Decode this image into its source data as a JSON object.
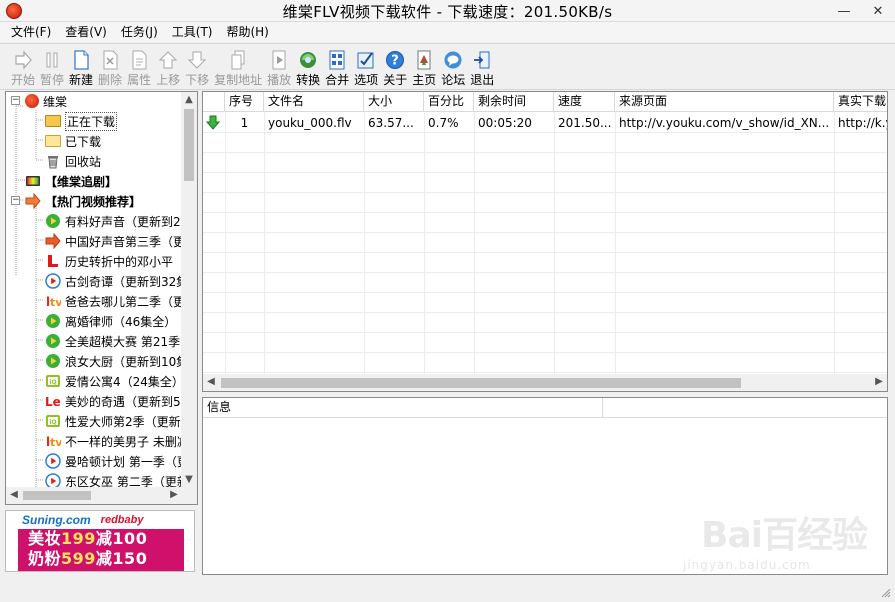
{
  "window": {
    "title": "维棠FLV视频下载软件 - 下载速度：201.50KB/s",
    "icons": {
      "app": "vidown-logo-icon",
      "minimize": "minimize-icon",
      "close": "close-icon"
    }
  },
  "menu": [
    {
      "label": "文件(F)"
    },
    {
      "label": "查看(V)"
    },
    {
      "label": "任务(J)"
    },
    {
      "label": "工具(T)"
    },
    {
      "label": "帮助(H)"
    }
  ],
  "toolbar": [
    {
      "label": "开始",
      "icon": "start-arrow-icon",
      "enabled": false
    },
    {
      "label": "暂停",
      "icon": "pause-icon",
      "enabled": false
    },
    {
      "label": "新建",
      "icon": "new-file-icon",
      "enabled": true
    },
    {
      "label": "删除",
      "icon": "delete-icon",
      "enabled": false
    },
    {
      "label": "属性",
      "icon": "properties-icon",
      "enabled": false
    },
    {
      "label": "上移",
      "icon": "move-up-icon",
      "enabled": false
    },
    {
      "label": "下移",
      "icon": "move-down-icon",
      "enabled": false
    },
    {
      "label": "复制地址",
      "icon": "copy-address-icon",
      "enabled": false
    },
    {
      "label": "播放",
      "icon": "play-icon",
      "enabled": false
    },
    {
      "label": "转换",
      "icon": "convert-icon",
      "enabled": true
    },
    {
      "label": "合并",
      "icon": "merge-icon",
      "enabled": true
    },
    {
      "label": "选项",
      "icon": "options-icon",
      "enabled": true
    },
    {
      "label": "关于",
      "icon": "about-icon",
      "enabled": true
    },
    {
      "label": "主页",
      "icon": "homepage-icon",
      "enabled": true
    },
    {
      "label": "论坛",
      "icon": "forum-icon",
      "enabled": true
    },
    {
      "label": "退出",
      "icon": "exit-icon",
      "enabled": true
    }
  ],
  "tree": {
    "root": {
      "label": "维棠",
      "icon": "vidown-logo-icon"
    },
    "children": [
      {
        "label": "正在下载",
        "icon": "downloading-folder-icon",
        "selected": true
      },
      {
        "label": "已下载",
        "icon": "downloaded-folder-icon"
      },
      {
        "label": "回收站",
        "icon": "recycle-bin-icon"
      }
    ],
    "drama": {
      "label": "【维棠追剧】",
      "icon": "tv-icon"
    },
    "hot": {
      "label": "【热门视频推荐】",
      "icon": "hot-arrow-icon"
    },
    "videos": [
      {
        "label": "有料好声音（更新到2",
        "icon": "tencent-video-icon"
      },
      {
        "label": "中国好声音第三季（更",
        "icon": "arrow-right-icon"
      },
      {
        "label": "历史转折中的邓小平（",
        "icon": "letv-l-icon"
      },
      {
        "label": "古剑奇谭（更新到32集",
        "icon": "youku-play-icon"
      },
      {
        "label": "爸爸去哪儿第二季（更",
        "icon": "letv-tv-icon"
      },
      {
        "label": "离婚律师（46集全）",
        "icon": "tencent-video-icon"
      },
      {
        "label": "全美超模大赛 第21季",
        "icon": "tencent-video-icon"
      },
      {
        "label": "浪女大厨（更新到10集",
        "icon": "tencent-video-icon"
      },
      {
        "label": "爱情公寓4（24集全）",
        "icon": "iqiyi-icon"
      },
      {
        "label": "美妙的奇遇（更新到5",
        "icon": "le-icon"
      },
      {
        "label": "性爱大师第2季（更新",
        "icon": "iqiyi-icon"
      },
      {
        "label": "不一样的美男子 未删减",
        "icon": "letv-tv-icon"
      },
      {
        "label": "曼哈顿计划 第一季（更",
        "icon": "youku-play-icon"
      },
      {
        "label": "东区女巫 第二季（更新",
        "icon": "youku-play-icon"
      }
    ]
  },
  "ad": {
    "brand1": "Suning.com",
    "brand2": "redbaby",
    "line1_prefix": "美妆",
    "line1_num": "199",
    "line1_suffix": "减100",
    "line2_prefix": "奶粉",
    "line2_num": "599",
    "line2_suffix": "减150"
  },
  "filelist": {
    "columns": [
      "序号",
      "文件名",
      "大小",
      "百分比",
      "剩余时间",
      "速度",
      "来源页面",
      "真实下载"
    ],
    "rows": [
      {
        "status_icon": "download-arrow-green-icon",
        "index": "1",
        "filename": "youku_000.flv",
        "size": "63.57...",
        "percent": "0.7%",
        "remaining": "00:05:20",
        "speed": "201.50...",
        "source": "http://v.youku.com/v_show/id_XN...",
        "real": "http://k.y"
      }
    ]
  },
  "info": {
    "columns": [
      "信息",
      ""
    ]
  },
  "watermark": {
    "text": "Bai百经验",
    "sub": "jingyan.baidu.com"
  },
  "colors": {
    "accent_green": "#2aa52a",
    "ad_bg": "#d0116c",
    "selected_folder": "#f5c84a"
  }
}
